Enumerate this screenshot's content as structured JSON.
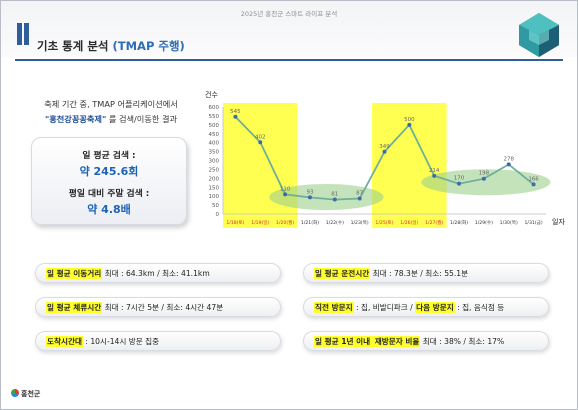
{
  "header": {
    "subtitle": "2025년 홍천군 스마트 라이프 분석",
    "title_main": "기초 통계 분석 ",
    "title_accent": "(TMAP 주행)"
  },
  "intro": {
    "line1": "축제 기간 중, TMAP 어플리케이션에서",
    "keyword": "\"홍천강꽁꽁축제\"",
    "line2_rest": " 를 검색/이동한 결과"
  },
  "stats": {
    "daily_label": "일 평균 검색 :",
    "daily_value": "약 245.6회",
    "ratio_label": "평일 대비 주말 검색 :",
    "ratio_value": "약 4.8배"
  },
  "chart_data": {
    "type": "line",
    "ylabel": "건수",
    "xlabel": "일자",
    "ylim": [
      0,
      600
    ],
    "yticks": [
      0,
      50,
      100,
      150,
      200,
      250,
      300,
      350,
      400,
      450,
      500,
      550,
      600
    ],
    "categories": [
      "1/18(토)",
      "1/19(일)",
      "1/20(월)",
      "1/21(화)",
      "1/22(수)",
      "1/23(목)",
      "1/25(토)",
      "1/26(일)",
      "1/27(월)",
      "1/28(화)",
      "1/29(수)",
      "1/30(목)",
      "1/31(금)"
    ],
    "weekend_or_holiday": [
      true,
      true,
      true,
      false,
      false,
      false,
      true,
      true,
      true,
      false,
      false,
      false,
      false
    ],
    "values": [
      545,
      402,
      110,
      93,
      81,
      87,
      349,
      500,
      214,
      170,
      198,
      278,
      166
    ],
    "line_color": "#6fae9a",
    "point_color": "#3b6ea8",
    "highlight_color": "#ffff33",
    "ellipse_color": "#9fd18c"
  },
  "facts": {
    "move_dist_label": "일 평균 이동거리",
    "move_dist_text": " 최대 : 64.3km / 최소: 41.1km",
    "drive_time_label": "일 평균 운전시간",
    "drive_time_text": " 최대 : 78.3분 / 최소: 55.1분",
    "stay_label": "일 평균 체류시간",
    "stay_text": " 최대 : 7시간 5분 / 최소: 4시간 47분",
    "prev_visit_label": "직전 방문지",
    "prev_visit_text": " : 집, 비발디파크 / ",
    "next_visit_label": "다음 방문지",
    "next_visit_text": " : 집, 음식점 등",
    "arrival_label": "도착시간대",
    "arrival_text": " : 10시-14시 방문 집중",
    "revisit_pre": "일 평균 1년 이내 ",
    "revisit_label": "재방문자 비율",
    "revisit_text": " 최대 : 38% / 최소: 17%"
  },
  "footer": {
    "logo_text": "홍천군"
  }
}
